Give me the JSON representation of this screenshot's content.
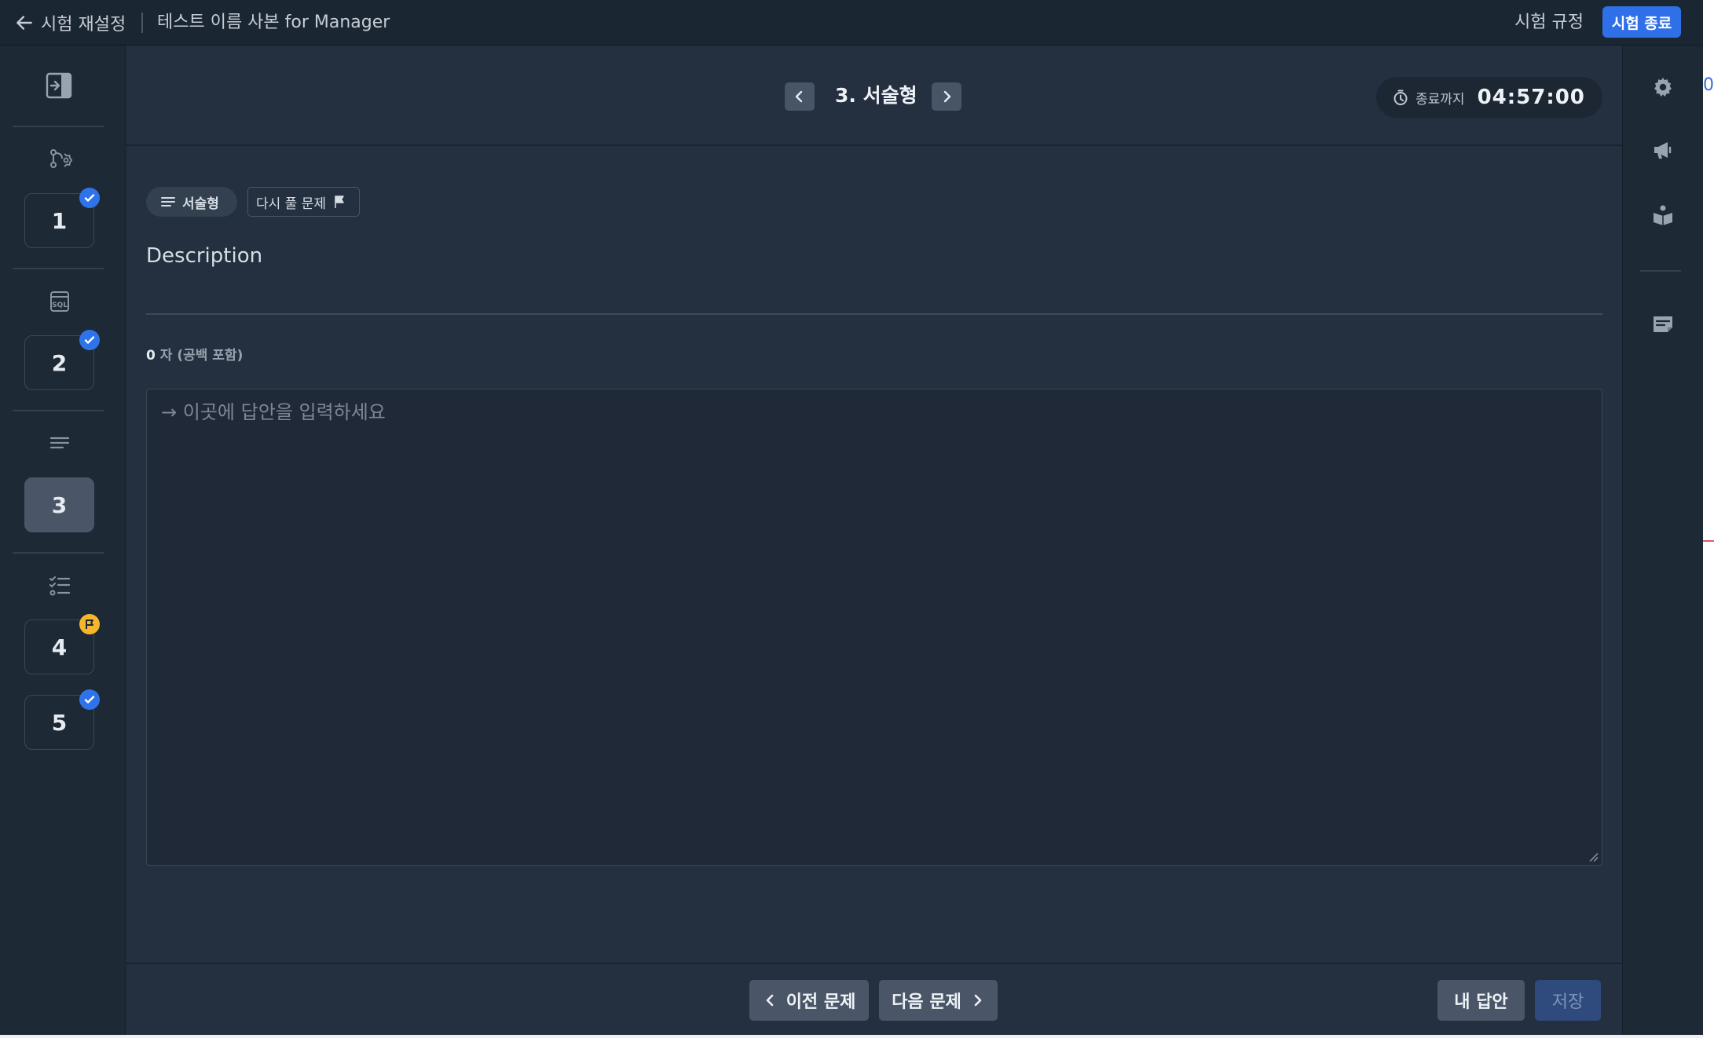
{
  "topbar": {
    "back_label": "시험 재설정",
    "exam_name": "테스트 이름 사본 for Manager",
    "rules_label": "시험 규정",
    "end_button": "시험 종료"
  },
  "sidebar": {
    "questions": [
      {
        "number": "1",
        "type_icon": "coding-icon",
        "status": "answered"
      },
      {
        "number": "2",
        "type_icon": "sql-icon",
        "status": "answered"
      },
      {
        "number": "3",
        "type_icon": "essay-icon",
        "status": "current"
      },
      {
        "number": "4",
        "type_icon": "multiple-choice-icon",
        "status": "flagged"
      },
      {
        "number": "5",
        "type_icon": "multiple-choice-icon",
        "status": "answered"
      }
    ]
  },
  "question": {
    "title": "3. 서술형",
    "timer_label": "종료까지",
    "timer_value": "04:57:00",
    "type_chip": "서술형",
    "review_chip": "다시 풀 문제",
    "description": "Description",
    "char_count": "0",
    "char_count_suffix": " 자 (공백 포함)",
    "answer_placeholder": "이곳에 답안을 입력하세요",
    "answer_value": ""
  },
  "footer": {
    "prev_label": "이전 문제",
    "next_label": "다음 문제",
    "my_answers_label": "내 답안",
    "save_label": "저장"
  },
  "right_strip": {
    "peek_text": "0"
  },
  "colors": {
    "accent": "#2f6fe8",
    "answered_badge": "#2f73ea",
    "flag_badge": "#f5b62c",
    "background": "#243040"
  }
}
